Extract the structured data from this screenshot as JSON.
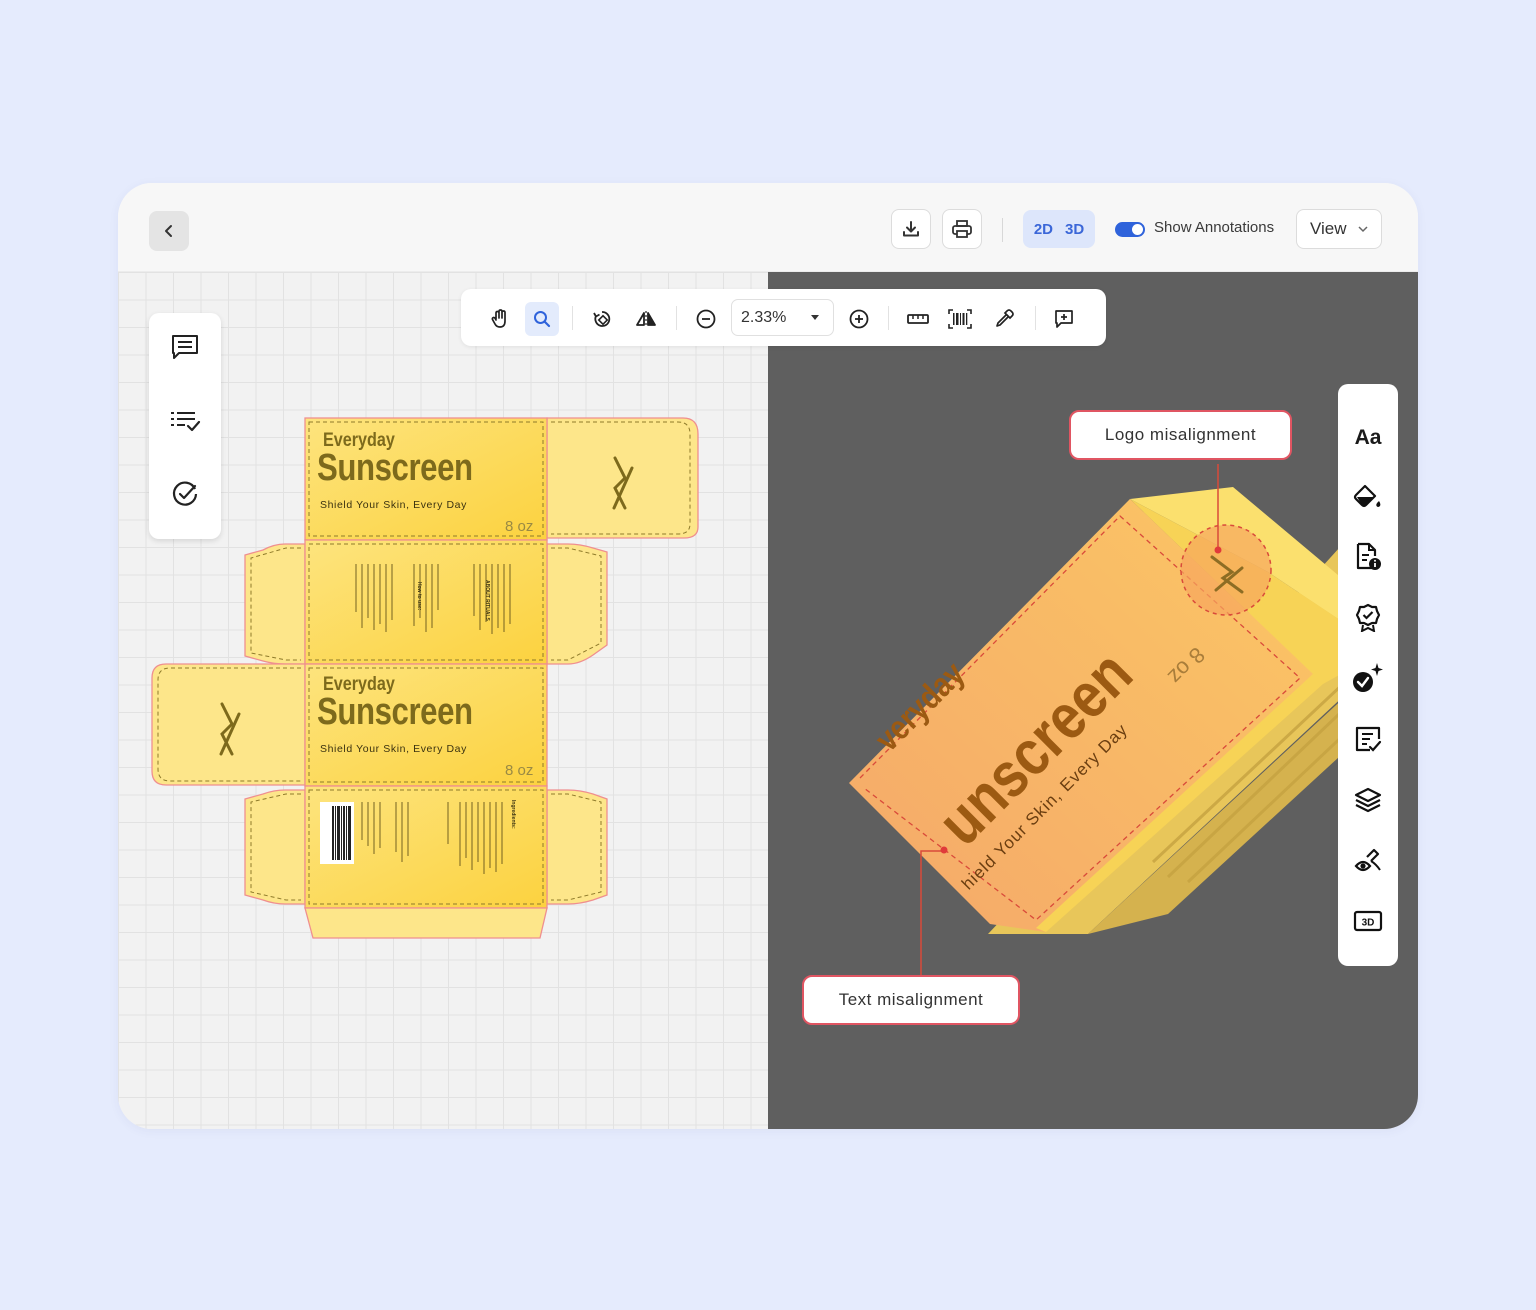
{
  "toolbar_top": {
    "dim_2d": "2D",
    "dim_3d": "3D",
    "show_annotations_label": "Show Annotations",
    "show_annotations_on": true,
    "view_label": "View"
  },
  "canvas_toolbar": {
    "zoom_value": "2.33%",
    "active_tool": "search"
  },
  "dieline": {
    "brand_line1": "Everyday",
    "brand_line2": "Sunscreen",
    "tagline": "Shield Your Skin, Every Day",
    "size": "8 oz",
    "about_heading": "ABOUT RITUALS",
    "how_to_heading": "How to use:",
    "ingredients_heading": "Ingredients:"
  },
  "mockup": {
    "brand_line1": "veryday",
    "brand_line2": "unscreen",
    "tagline": "hield Your Skin, Every Day",
    "size": "8 oz"
  },
  "annotations": [
    {
      "label": "Logo misalignment"
    },
    {
      "label": "Text misalignment"
    }
  ],
  "right_panel": {
    "text_icon_label": "Aa"
  },
  "colors": {
    "accent_blue": "#2f63db",
    "annotation_red": "#e05562",
    "dieline_yellow": "#fde68a",
    "label_olive": "#7d6a1c"
  }
}
